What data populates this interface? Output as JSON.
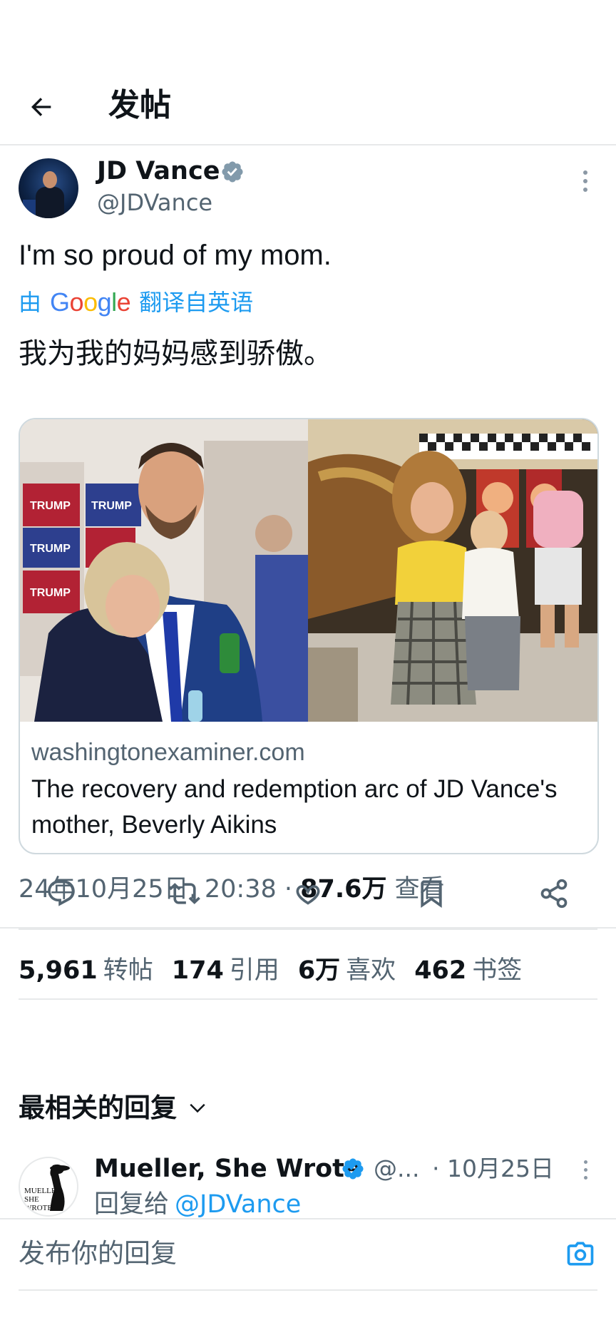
{
  "header": {
    "title": "发帖",
    "back_icon": "arrow-left-icon"
  },
  "tweet": {
    "author_name": "JD Vance",
    "handle": "@JDVance",
    "text": "I'm so proud of my mom.",
    "translate_prefix": "由",
    "translate_brand": "Google",
    "translate_suffix": "翻译自英语",
    "translated_text": "我为我的妈妈感到骄傲。",
    "card": {
      "domain": "washingtonexaminer.com",
      "title": "The recovery and redemption arc of JD Vance's mother, Beverly Aikins"
    },
    "timestamp": "24年10月25日, 20:38",
    "separator": "·",
    "views_count": "87.6万",
    "views_label": "查看",
    "stats": [
      {
        "value": "5,961",
        "label": "转帖"
      },
      {
        "value": "174",
        "label": "引用"
      },
      {
        "value": "6万",
        "label": "喜欢"
      },
      {
        "value": "462",
        "label": "书签"
      }
    ]
  },
  "actions": {
    "icons": [
      "reply-icon",
      "retweet-icon",
      "like-icon",
      "bookmark-icon",
      "share-icon"
    ]
  },
  "replies": {
    "sort_label": "最相关的回复",
    "items": [
      {
        "name": "Mueller, She Wrote",
        "handle": "@...",
        "time": "· 10月25日",
        "reply_to_label": "回复给",
        "reply_to_handle": "@JDVance",
        "avatar_text": "MUELLER SHE WROTE"
      }
    ]
  },
  "composer": {
    "placeholder": "发布你的回复",
    "camera_icon": "camera-icon"
  },
  "colors": {
    "accent": "#1d9bf0",
    "verified": "#829aab",
    "text": "#0f1419",
    "muted": "#536471"
  }
}
